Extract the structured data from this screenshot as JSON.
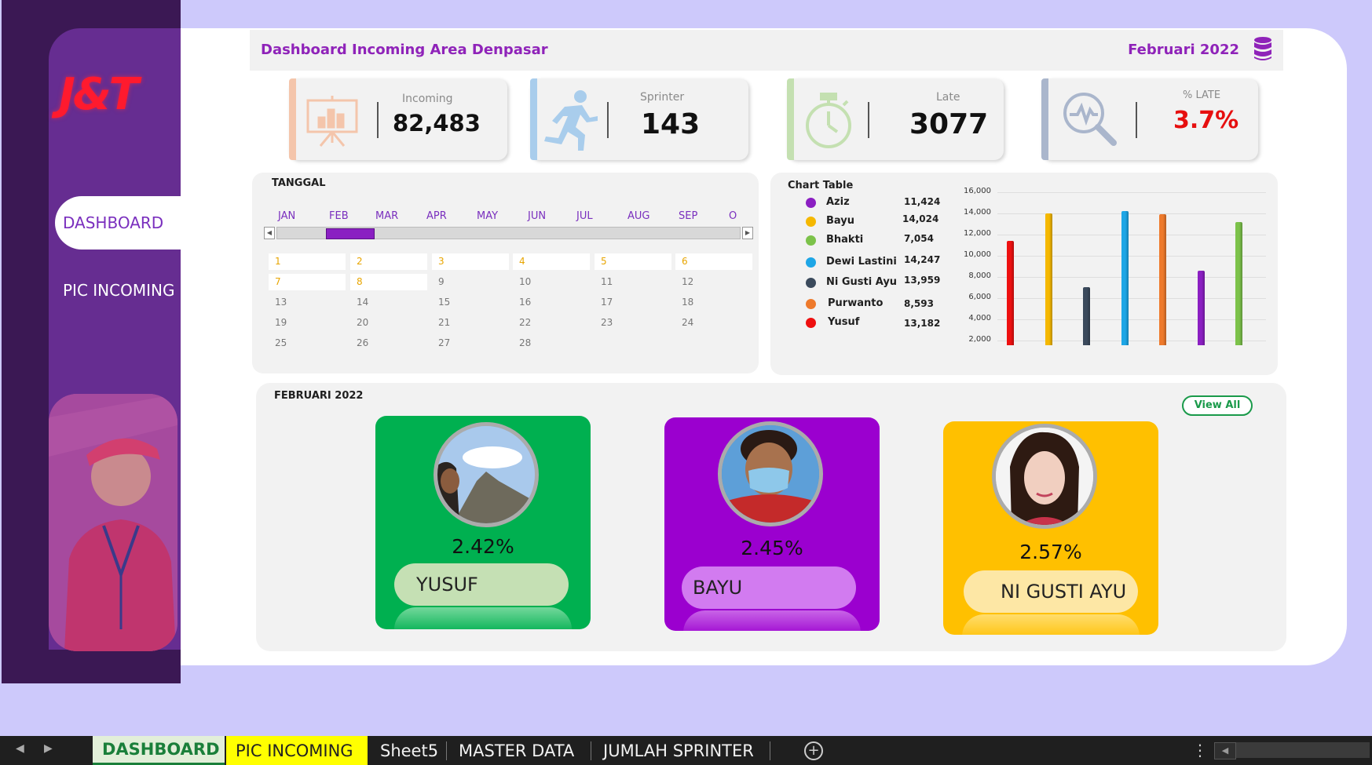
{
  "sidebar": {
    "logo_text": "J&T",
    "nav": [
      {
        "label": "DASHBOARD",
        "active": true
      },
      {
        "label": "PIC INCOMING",
        "active": false
      }
    ]
  },
  "header": {
    "title": "Dashboard Incoming Area Denpasar",
    "period": "Februari 2022",
    "icon": "database-icon"
  },
  "kpis": [
    {
      "label": "Incoming",
      "value": "82,483",
      "icon": "presentation-chart-icon",
      "accent": "#f4c5ab"
    },
    {
      "label": "Sprinter",
      "value": "143",
      "icon": "running-person-icon",
      "accent": "#a9cdec"
    },
    {
      "label": "Late",
      "value": "3077",
      "icon": "stopwatch-icon",
      "accent": "#c4e0b1"
    },
    {
      "label": "% LATE",
      "value": "3.7%",
      "icon": "magnifier-pulse-icon",
      "accent": "#aab6cc",
      "value_color": "#e60f0f"
    }
  ],
  "timeline": {
    "title": "TANGGAL",
    "months": [
      "JAN",
      "FEB",
      "MAR",
      "APR",
      "MAY",
      "JUN",
      "JUL",
      "AUG",
      "SEP",
      "O"
    ],
    "selected_month": "FEB",
    "days": [
      [
        "1",
        "2",
        "3",
        "4",
        "5",
        "6"
      ],
      [
        "7",
        "8",
        "9",
        "10",
        "11",
        "12"
      ],
      [
        "13",
        "14",
        "15",
        "16",
        "17",
        "18"
      ],
      [
        "19",
        "20",
        "21",
        "22",
        "23",
        "24"
      ],
      [
        "25",
        "26",
        "27",
        "28"
      ]
    ],
    "selected_days": [
      "1",
      "2",
      "3",
      "4",
      "5",
      "6",
      "7",
      "8"
    ]
  },
  "chart_table": {
    "title": "Chart Table",
    "rows": [
      {
        "name": "Aziz",
        "value": "11,424",
        "color": "#8b1fc2"
      },
      {
        "name": "Bayu",
        "value": "14,024",
        "color": "#f5b800"
      },
      {
        "name": "Bhakti",
        "value": "7,054",
        "color": "#7cc24a"
      },
      {
        "name": "Dewi Lastini",
        "value": "14,247",
        "color": "#1ea6e6"
      },
      {
        "name": "Ni Gusti Ayu",
        "value": "13,959",
        "color": "#3b4a5c"
      },
      {
        "name": "Purwanto",
        "value": "8,593",
        "color": "#ee7a2c"
      },
      {
        "name": "Yusuf",
        "value": "13,182",
        "color": "#ee1010"
      }
    ]
  },
  "chart_data": {
    "type": "bar",
    "title": "",
    "xlabel": "",
    "ylabel": "",
    "ylim": [
      2000,
      16000
    ],
    "yticks": [
      "2,000",
      "4,000",
      "6,000",
      "8,000",
      "10,000",
      "12,000",
      "14,000",
      "16,000"
    ],
    "series": [
      {
        "color": "#ee1010",
        "value": 11424
      },
      {
        "color": "#f5b800",
        "value": 14024
      },
      {
        "color": "#3b4a5c",
        "value": 7054
      },
      {
        "color": "#1ea6e6",
        "value": 14247
      },
      {
        "color": "#ee7a2c",
        "value": 13959
      },
      {
        "color": "#8b1fc2",
        "value": 8593
      },
      {
        "color": "#7cc24a",
        "value": 13182
      }
    ]
  },
  "pic_section": {
    "title": "FEBRUARI 2022",
    "view_all": "View All",
    "cards": [
      {
        "name": "YUSUF",
        "pct": "2.42%",
        "bg": "#00b050",
        "pill": "#c5e0b4"
      },
      {
        "name": "BAYU",
        "pct": "2.45%",
        "bg": "#9b00cf",
        "pill": "#d27bf0"
      },
      {
        "name": "NI GUSTI AYU",
        "pct": "2.57%",
        "bg": "#ffc000",
        "pill": "#fde7a5"
      }
    ]
  },
  "sheet_tabs": [
    {
      "label": "DASHBOARD",
      "active": true
    },
    {
      "label": "PIC INCOMING",
      "highlight": "#ffff00"
    },
    {
      "label": "Sheet5"
    },
    {
      "label": "MASTER DATA"
    },
    {
      "label": "JUMLAH SPRINTER"
    }
  ]
}
